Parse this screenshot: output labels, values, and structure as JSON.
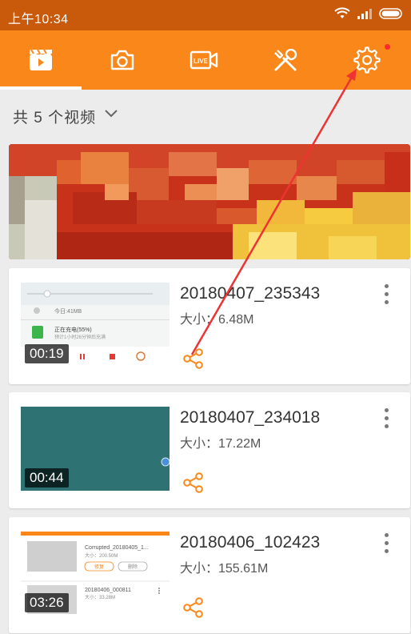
{
  "status_bar": {
    "time": "上午10:34"
  },
  "toolbar": {
    "tabs": [
      {
        "icon": "video-list-icon",
        "active": true
      },
      {
        "icon": "camera-icon",
        "active": false
      },
      {
        "icon": "live-icon",
        "label": "LIVE",
        "active": false
      },
      {
        "icon": "tools-icon",
        "active": false
      },
      {
        "icon": "settings-icon",
        "active": false,
        "badge": true
      }
    ]
  },
  "filter": {
    "label": "共 5 个视频"
  },
  "videos": [
    {
      "title": "20180407_235343",
      "size": "大小：6.48M",
      "duration": "00:19"
    },
    {
      "title": "20180407_234018",
      "size": "大小：17.22M",
      "duration": "00:44"
    },
    {
      "title": "20180406_102423",
      "size": "大小：155.61M",
      "duration": "03:26"
    }
  ],
  "thumb1": {
    "row1": "今日:41MB",
    "row2": "正在充电(55%)",
    "row3": "预计1小时26分钟后充满"
  },
  "thumb3": {
    "item1_title": "Corrupted_20180405_1...",
    "item1_size": "大小：200.50M",
    "item1_btn1": "修复",
    "item1_btn2": "删除",
    "item2_title": "20180406_000811",
    "item2_size": "大小：33.28M"
  },
  "colors": {
    "status_bar": "#c95a0c",
    "toolbar": "#f98719",
    "accent": "#f98719",
    "annotation_arrow": "#ee3333"
  }
}
